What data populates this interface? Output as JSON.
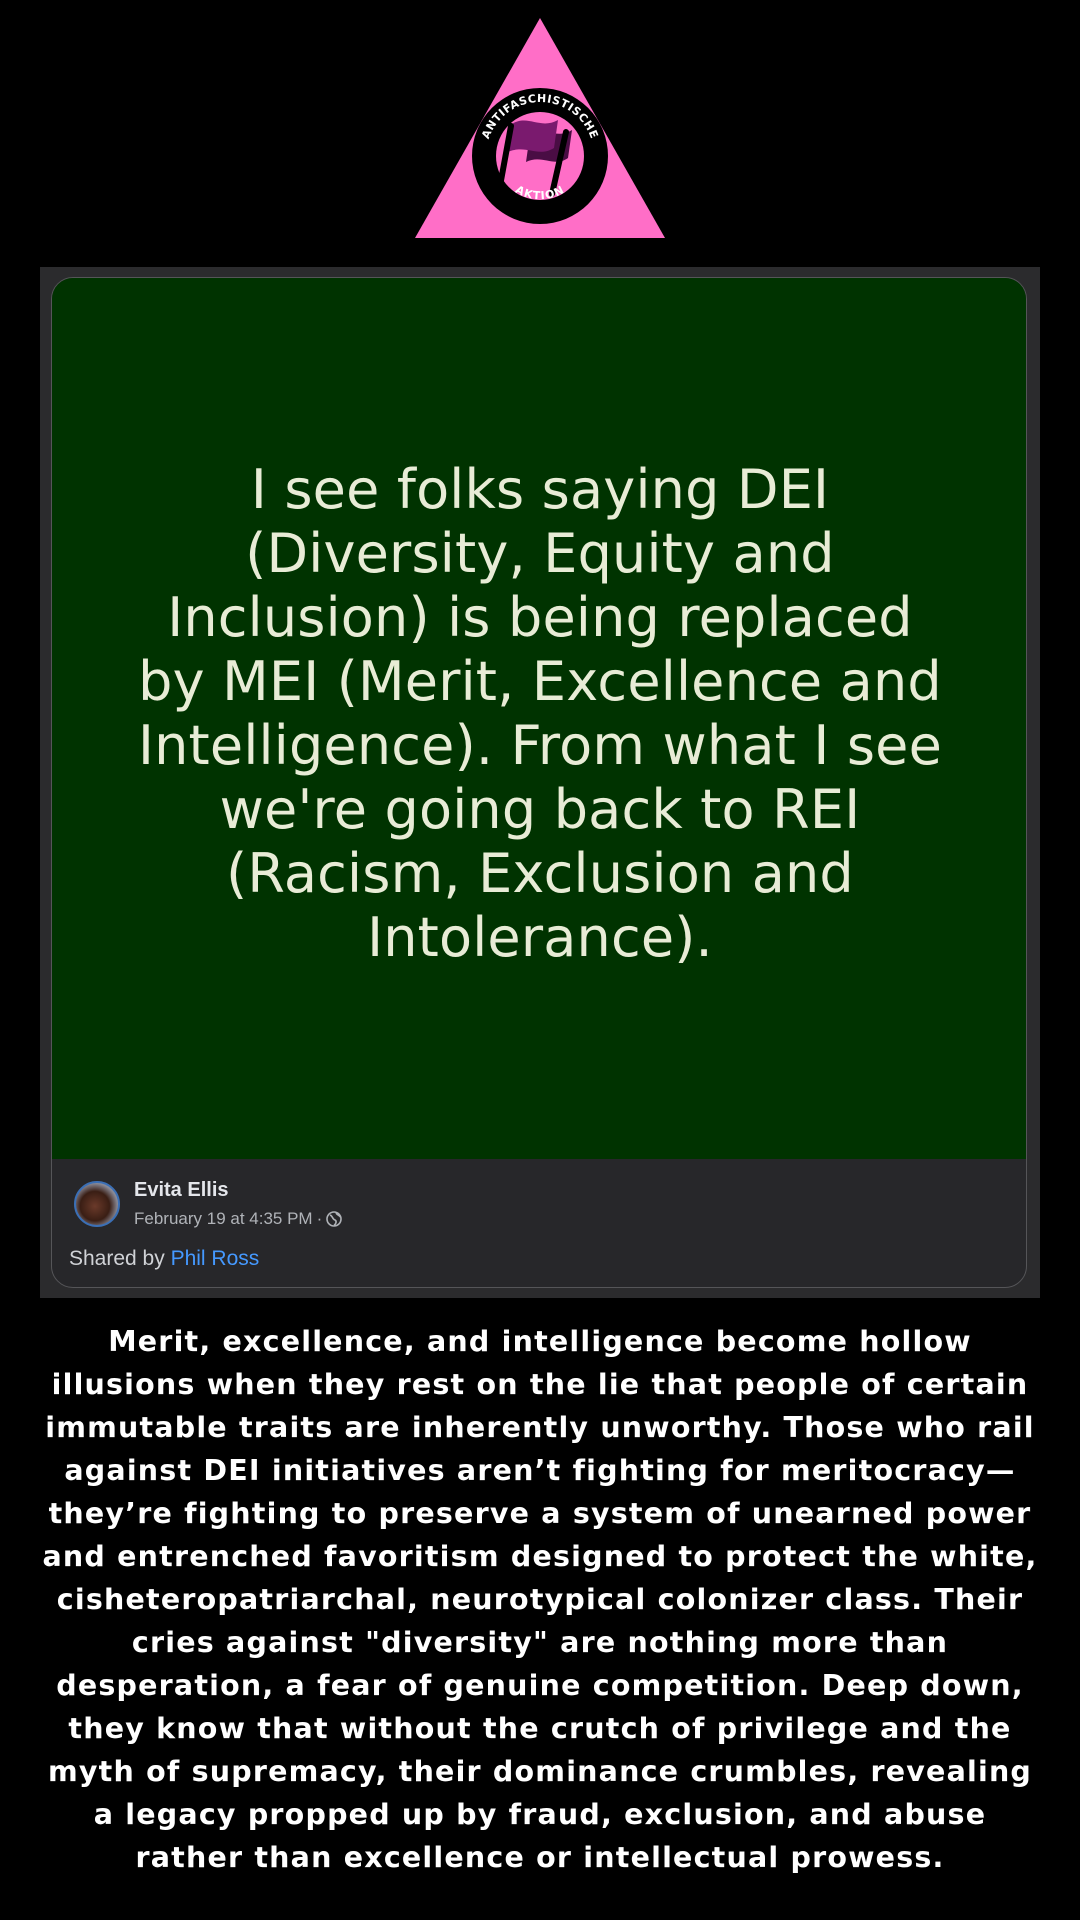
{
  "logo": {
    "top_text": "ANTIFASCHISTISCHE",
    "bottom_text": "AKTION",
    "colors": {
      "triangle": "#ff6ec7",
      "ring": "#000000",
      "flag_front": "#7a1a6e",
      "flag_back": "#4a0d44"
    }
  },
  "post": {
    "image_text": "I see folks saying DEI (Diversity, Equity and Inclusion) is being replaced by MEI (Merit, Excellence and Intelligence). From what I see we're going back to REI  (Racism, Exclusion and Intolerance).",
    "image_bg_color": "#003300",
    "author": "Evita Ellis",
    "date": "February 19 at 4:35 PM",
    "separator": "·",
    "visibility_icon": "globe-icon",
    "shared_by_label": "Shared by",
    "shared_by_name": "Phil Ross",
    "link_color": "#4599ff"
  },
  "caption": "Merit, excellence, and intelligence become hollow illusions when they rest on the lie that people of certain immutable traits are inherently unworthy. Those who rail against DEI initiatives aren’t fighting for meritocracy—they’re fighting to preserve a system of unearned power and entrenched favoritism designed to protect the white, cisheteropatriarchal, neurotypical colonizer class. Their cries against \"diversity\" are nothing more than desperation, a fear of genuine competition. Deep down, they know that without the crutch of privilege and the myth of supremacy, their dominance crumbles, revealing a legacy propped up by fraud, exclusion, and abuse rather than excellence or intellectual prowess."
}
